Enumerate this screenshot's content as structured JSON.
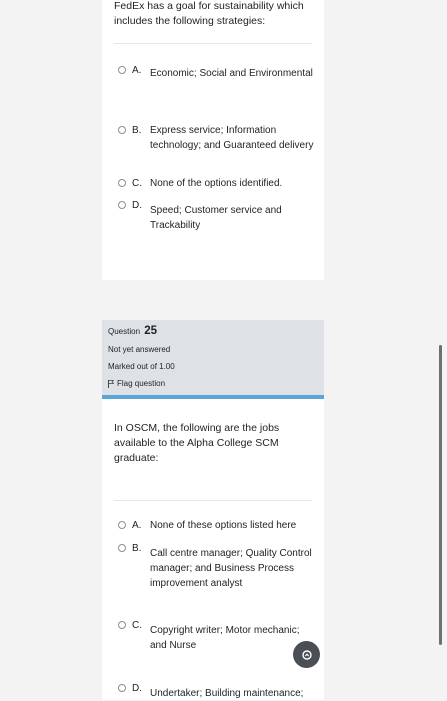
{
  "question24": {
    "text": "FedEx has a goal for sustainability which includes the following strategies:",
    "options": [
      {
        "letter": "A.",
        "label": "Economic; Social and Environmental"
      },
      {
        "letter": "B.",
        "label": "Express service; Information technology; and Guaranteed delivery"
      },
      {
        "letter": "C.",
        "label": "None of the options identified."
      },
      {
        "letter": "D.",
        "label": "Speed; Customer service and Trackability"
      }
    ]
  },
  "question25": {
    "label": "Question",
    "number": "25",
    "status": "Not yet answered",
    "marks": "Marked out of 1.00",
    "flag": "Flag question",
    "text": "In OSCM, the following are the jobs available to the Alpha College SCM graduate:",
    "options": [
      {
        "letter": "A.",
        "label": "None of these options listed here"
      },
      {
        "letter": "B.",
        "label": "Call centre manager; Quality Control manager; and Business Process improvement analyst"
      },
      {
        "letter": "C.",
        "label": "Copyright writer; Motor mechanic; and Nurse"
      },
      {
        "letter": "D.",
        "label": "Undertaker; Building maintenance;"
      }
    ]
  },
  "icons": {
    "flag": "flag-icon",
    "scroll_up": "chevron-up-icon"
  }
}
